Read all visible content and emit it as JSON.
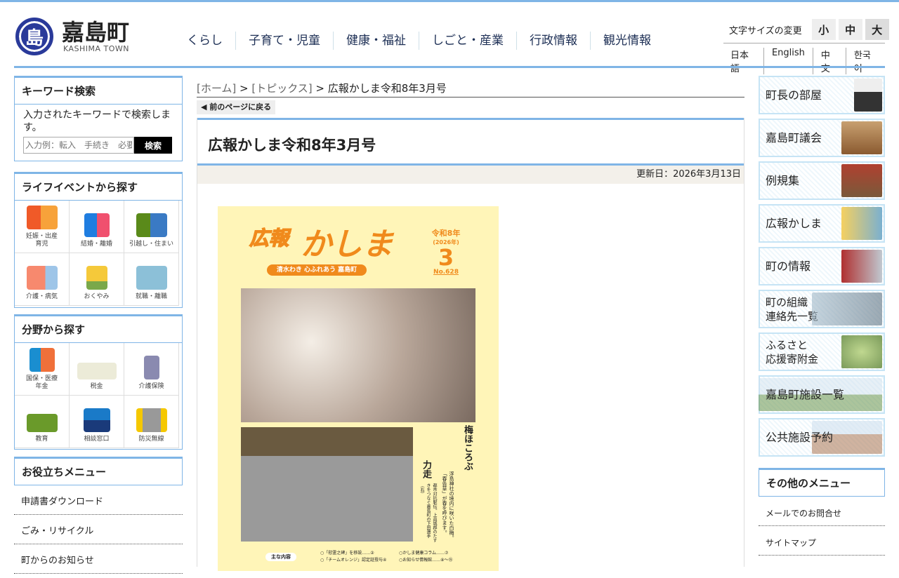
{
  "header": {
    "logo_kanji": "嘉島町",
    "logo_mark": "島",
    "logo_en": "KASHIMA TOWN",
    "nav": [
      "くらし",
      "子育て・児童",
      "健康・福祉",
      "しごと・産業",
      "行政情報",
      "観光情報"
    ],
    "font_size_label": "文字サイズの変更",
    "font_sizes": [
      "小",
      "中",
      "大"
    ],
    "languages": [
      "日本語",
      "English",
      "中文",
      "한국어"
    ]
  },
  "search": {
    "title": "キーワード検索",
    "desc": "入力されたキーワードで検索します。",
    "placeholder": "入力例：転入　手続き　必要書類",
    "button": "検索"
  },
  "life": {
    "title": "ライフイベントから探す",
    "items": [
      "妊娠・出産\n育児",
      "結婚・離婚",
      "引越し・住まい",
      "介護・病気",
      "おくやみ",
      "就職・離職"
    ]
  },
  "field": {
    "title": "分野から探す",
    "items": [
      "国保・医療\n年金",
      "税金",
      "介護保険",
      "教育",
      "相談窓口",
      "防災無線"
    ]
  },
  "useful": {
    "title": "お役立ちメニュー",
    "items": [
      "申請書ダウンロード",
      "ごみ・リサイクル",
      "町からのお知らせ"
    ]
  },
  "breadcrumb": {
    "home": "[ホーム]",
    "sep": " > ",
    "topics": "[トピックス]",
    "current": "広報かしま令和8年3月号"
  },
  "back": "前のページに戻る",
  "page_title": "広報かしま令和8年3月号",
  "updated": "更新日：2026年3月13日",
  "cover": {
    "mast1": "広報",
    "mast2": "かしま",
    "slogan": "清水わき 心ふれあう 嘉島町",
    "era": "令和8年",
    "year": "(2026年)",
    "month": "3",
    "no": "No.628",
    "head1": "梅ほころぶ",
    "cap1": "浮島神社の境内に咲いた白梅。「春告草」が春を呼びます。",
    "head2": "力走",
    "cap2": "都市対抗駅伝。上益城郡のたすきをつなぐ嘉島町の下田選手（右）",
    "contents_label": "主な内容",
    "contents": [
      "○「慰霊之碑」を移設……②",
      "○「チームオレンジ」認定証授与④",
      "○かしま健康コラム……⑦",
      "○お知らせ情報館……⑧～⑮"
    ]
  },
  "right": {
    "banners": [
      "町長の部屋",
      "嘉島町議会",
      "例規集",
      "広報かしま",
      "町の情報",
      "町の組織\n連絡先一覧",
      "ふるさと\n応援寄附金",
      "嘉島町施設一覧",
      "公共施設予約"
    ],
    "other_title": "その他のメニュー",
    "other": [
      "メールでのお問合せ",
      "サイトマップ"
    ]
  },
  "colors": {
    "accent": "#7fb5e6",
    "cover_bg": "#fff5b8",
    "cover_orange": "#f08a1c"
  }
}
